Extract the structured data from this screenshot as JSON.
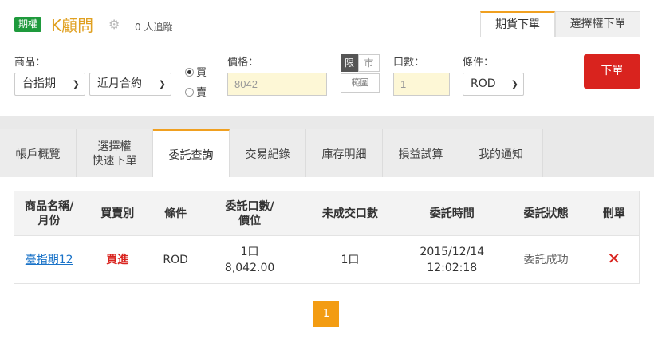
{
  "header": {
    "badge": "期權",
    "brand": "K顧問",
    "followers": "0 人追蹤",
    "tabs": [
      "期貨下單",
      "選擇權下單"
    ]
  },
  "order_form": {
    "product_label": "商品：",
    "product": "台指期",
    "contract": "近月合約",
    "side_buy": "買",
    "side_sell": "賣",
    "selected_side": "買",
    "price_label": "價格：",
    "price_value": "8042",
    "limit_label": "限",
    "market_label": "市",
    "range_label": "範圍",
    "qty_label": "口數：",
    "qty_value": "1",
    "cond_label": "條件：",
    "condition": "ROD",
    "submit": "下單"
  },
  "tabs": [
    {
      "label": "帳戶概覽"
    },
    {
      "label": "選擇權\n快速下單"
    },
    {
      "label": "委託查詢"
    },
    {
      "label": "交易紀錄"
    },
    {
      "label": "庫存明細"
    },
    {
      "label": "損益試算"
    },
    {
      "label": "我的通知"
    }
  ],
  "active_tab": "委託查詢",
  "table": {
    "headers": [
      "商品名稱/\n月份",
      "買賣別",
      "條件",
      "委託口數/\n價位",
      "未成交口數",
      "委託時間",
      "委託狀態",
      "刪單"
    ],
    "rows": [
      {
        "product": "臺指期12",
        "side": "買進",
        "condition": "ROD",
        "qty": "1口",
        "price": "8,042.00",
        "unfilled": "1口",
        "date": "2015/12/14",
        "time": "12:02:18",
        "status": "委託成功",
        "delete_icon": "close-x"
      }
    ]
  },
  "pagination": {
    "current": "1"
  },
  "colors": {
    "accent": "#f0a020",
    "brand_green": "#1e9a3c",
    "danger": "#d9231e",
    "link": "#1a73c8"
  }
}
